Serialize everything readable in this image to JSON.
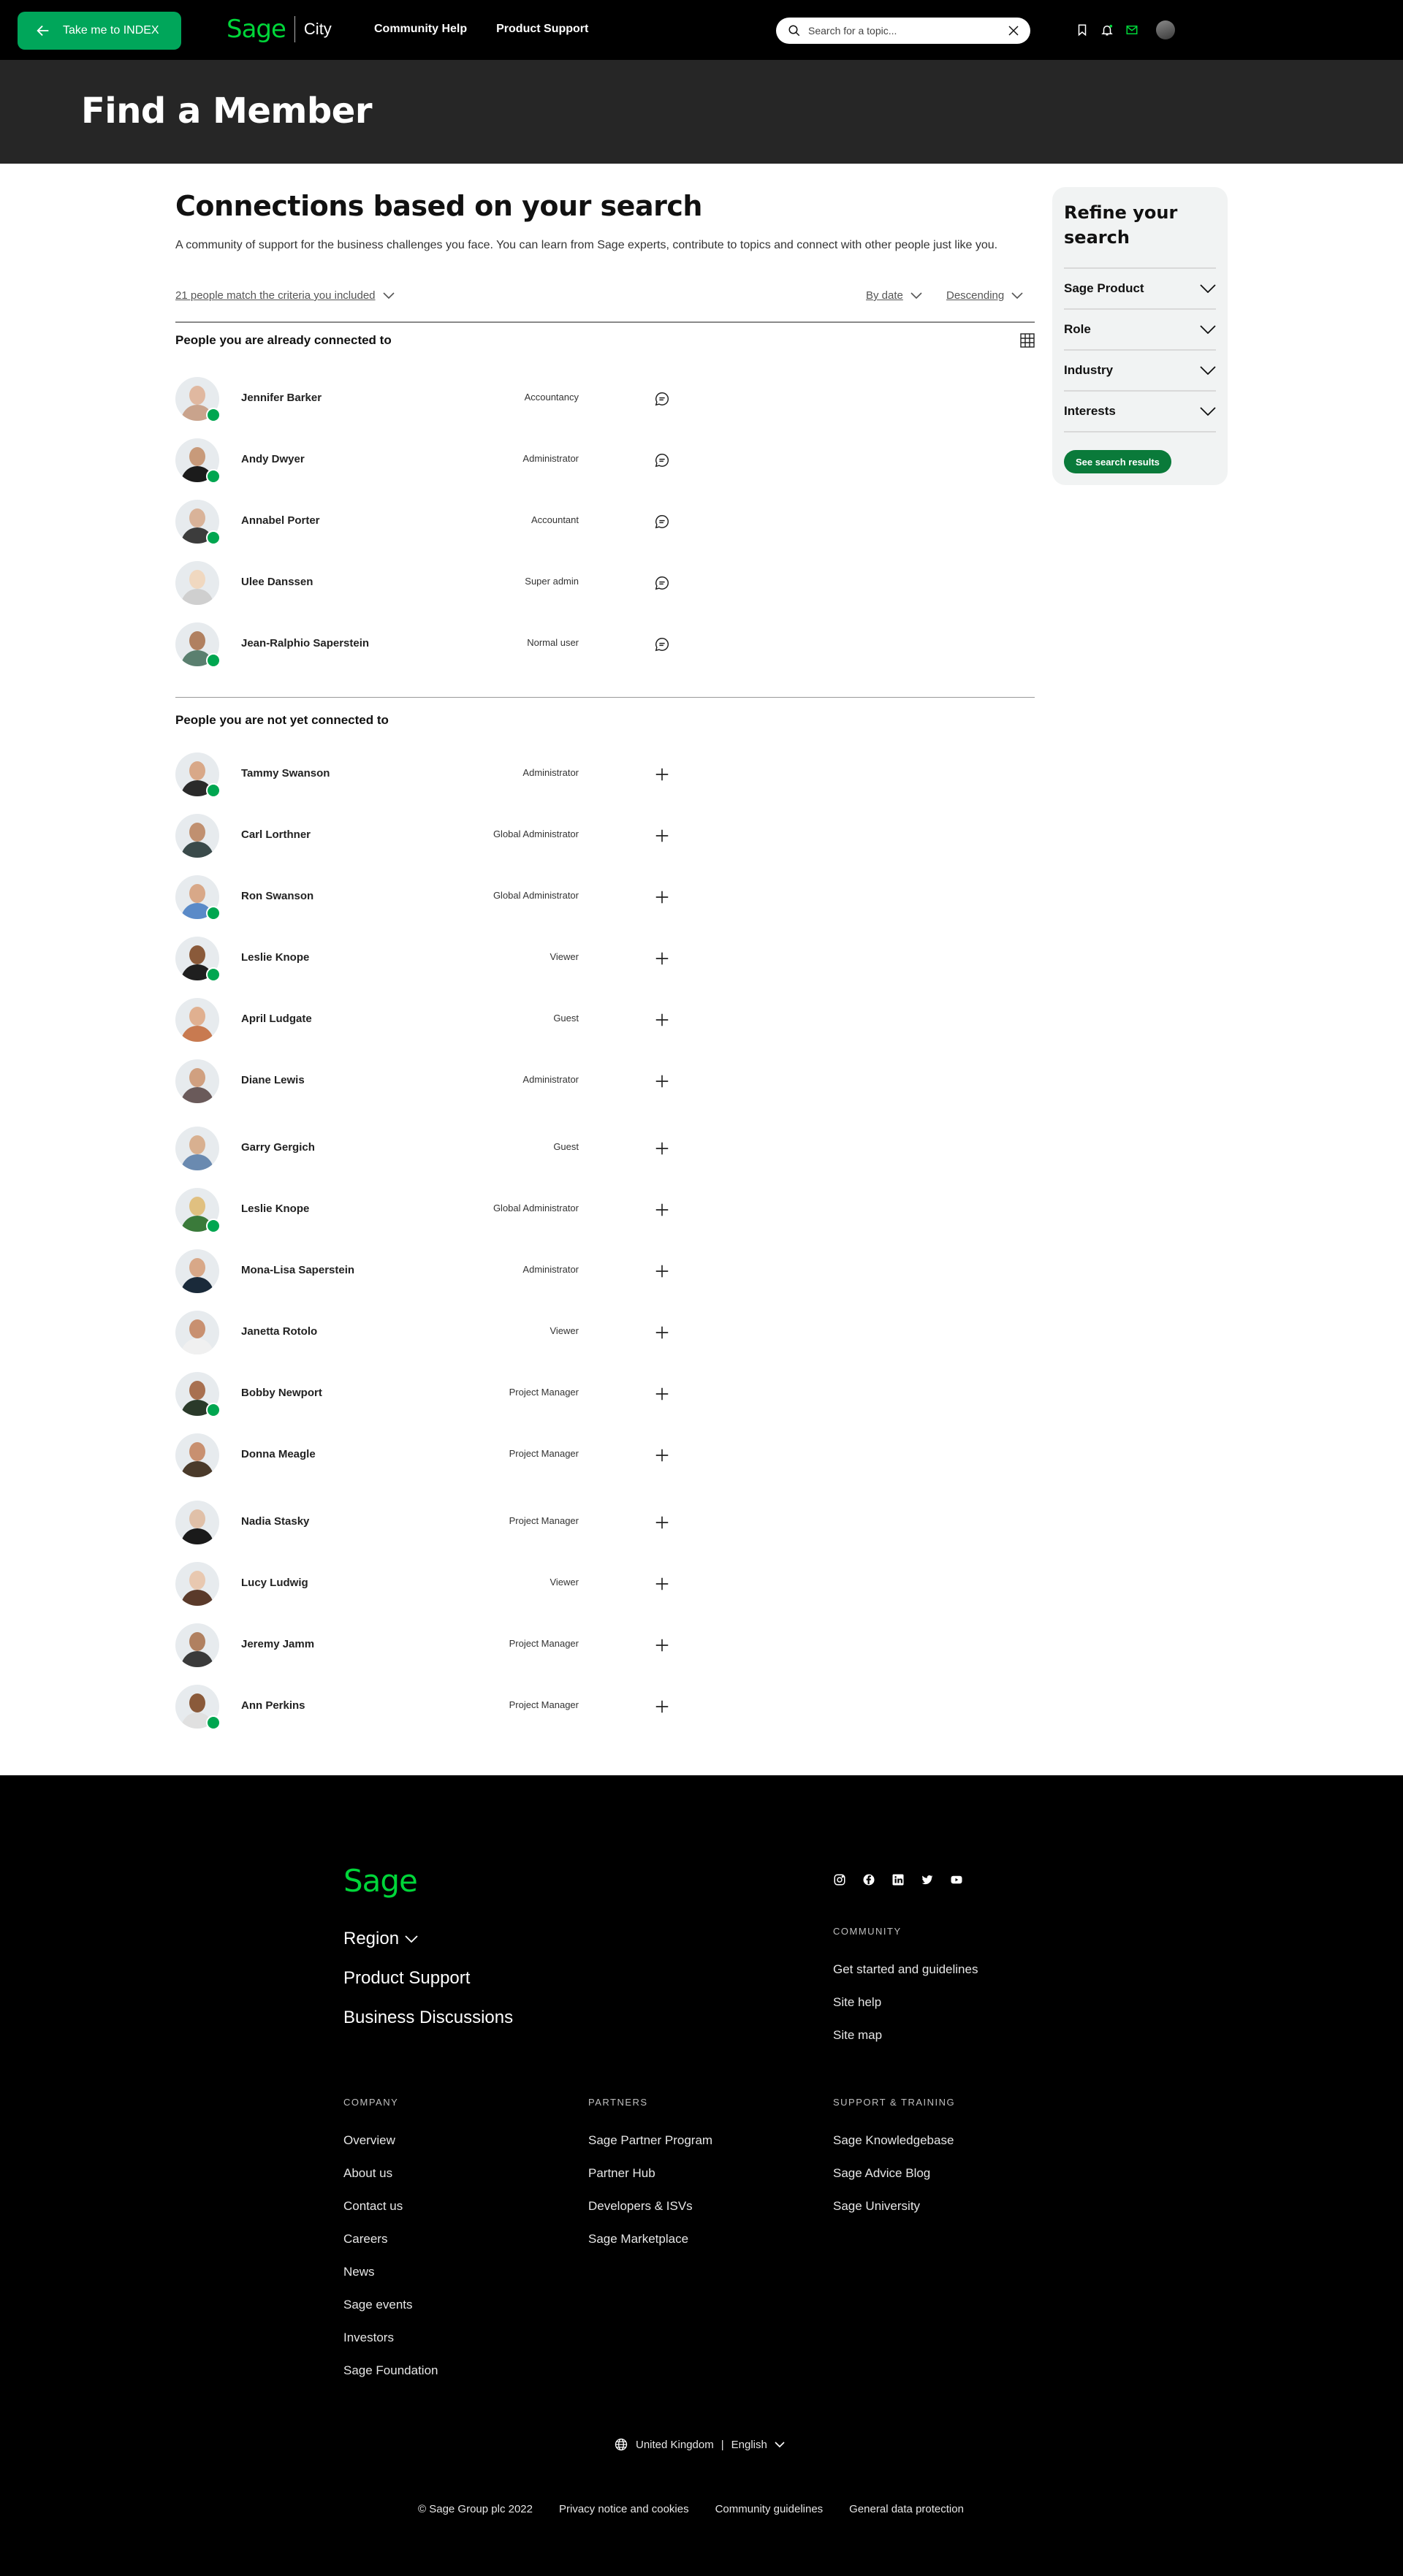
{
  "nav": {
    "back_label": "Take me to INDEX",
    "brand": "Sage",
    "brand_sub": "City",
    "links": [
      "Community Help",
      "Product Support"
    ],
    "search_placeholder": "Search for a topic..."
  },
  "hero": {
    "title": "Find a Member"
  },
  "main": {
    "title": "Connections based on your search",
    "intro": "A community of support for the business challenges you face. You can learn from Sage experts, contribute to topics and connect with other people just like you.",
    "match_text": "21 people match the criteria you included",
    "sort_by": "By date",
    "order": "Descending",
    "connected_title": "People you are already connected to",
    "not_connected_title": "People you are not yet connected to",
    "connected": [
      {
        "name": "Jennifer Barker",
        "role": "Accountancy",
        "online": true,
        "skin": "#e0b8a0",
        "cloth": "#c9a38c"
      },
      {
        "name": "Andy Dwyer",
        "role": "Administrator",
        "online": true,
        "skin": "#c89a7a",
        "cloth": "#1b1b1b"
      },
      {
        "name": "Annabel Porter",
        "role": "Accountant",
        "online": true,
        "skin": "#d9b399",
        "cloth": "#3c3c3c"
      },
      {
        "name": "Ulee Danssen",
        "role": "Super admin",
        "online": false,
        "skin": "#f0d8c0",
        "cloth": "#cfcfcf"
      },
      {
        "name": "Jean-Ralphio Saperstein",
        "role": "Normal user",
        "online": true,
        "skin": "#b08060",
        "cloth": "#5a7f6f"
      }
    ],
    "not_connected": [
      {
        "name": "Tammy Swanson",
        "role": "Administrator",
        "online": true,
        "skin": "#d8a888",
        "cloth": "#2a2a2a"
      },
      {
        "name": "Carl Lorthner",
        "role": "Global Administrator",
        "online": false,
        "skin": "#c09070",
        "cloth": "#3a4a4a"
      },
      {
        "name": "Ron Swanson",
        "role": "Global Administrator",
        "online": true,
        "skin": "#d8a888",
        "cloth": "#5a8ac8"
      },
      {
        "name": "Leslie Knope",
        "role": "Viewer",
        "online": true,
        "skin": "#8a5a3a",
        "cloth": "#1f1f1f"
      },
      {
        "name": "April Ludgate",
        "role": "Guest",
        "online": false,
        "skin": "#e0b090",
        "cloth": "#c87a50"
      },
      {
        "name": "Diane Lewis",
        "role": "Administrator",
        "online": false,
        "skin": "#d0a080",
        "cloth": "#6a5a5a"
      },
      {
        "name": "Garry Gergich",
        "role": "Guest",
        "online": false,
        "skin": "#d8b090",
        "cloth": "#6a8ab0"
      },
      {
        "name": "Leslie Knope",
        "role": "Global Administrator",
        "online": true,
        "skin": "#e0c080",
        "cloth": "#3a7a3a"
      },
      {
        "name": "Mona-Lisa Saperstein",
        "role": "Administrator",
        "online": false,
        "skin": "#d8a888",
        "cloth": "#1a2a3a"
      },
      {
        "name": "Janetta Rotolo",
        "role": "Viewer",
        "online": false,
        "skin": "#c89070",
        "cloth": "#f0f0f0"
      },
      {
        "name": "Bobby Newport",
        "role": "Project Manager",
        "online": true,
        "skin": "#a87050",
        "cloth": "#2a3a2a"
      },
      {
        "name": "Donna Meagle",
        "role": "Project Manager",
        "online": false,
        "skin": "#c89070",
        "cloth": "#4a3a2a"
      },
      {
        "name": "Nadia Stasky",
        "role": "Project Manager",
        "online": false,
        "skin": "#e0c0a8",
        "cloth": "#1a1a1a"
      },
      {
        "name": "Lucy Ludwig",
        "role": "Viewer",
        "online": false,
        "skin": "#e8c8b0",
        "cloth": "#5a3a2a"
      },
      {
        "name": "Jeremy Jamm",
        "role": "Project Manager",
        "online": false,
        "skin": "#b08060",
        "cloth": "#3a3a3a"
      },
      {
        "name": "Ann Perkins",
        "role": "Project Manager",
        "online": true,
        "skin": "#8a5a3a",
        "cloth": "#e0e0e0"
      }
    ]
  },
  "refine": {
    "title": "Refine your search",
    "filters": [
      "Sage Product",
      "Role",
      "Industry",
      "Interests"
    ],
    "button": "See search results"
  },
  "footer": {
    "logo": "Sage",
    "region": "Region",
    "big_links": [
      "Product Support",
      "Business Discussions"
    ],
    "socials": [
      "instagram-icon",
      "facebook-icon",
      "linkedin-icon",
      "twitter-icon",
      "youtube-icon"
    ],
    "community": {
      "heading": "COMMUNITY",
      "links": [
        "Get started and guidelines",
        "Site help",
        "Site map"
      ]
    },
    "company": {
      "heading": "COMPANY",
      "links": [
        "Overview",
        "About us",
        "Contact us",
        "Careers",
        "News",
        "Sage events",
        "Investors",
        "Sage Foundation"
      ]
    },
    "partners": {
      "heading": "PARTNERS",
      "links": [
        "Sage Partner Program",
        "Partner Hub",
        "Developers & ISVs",
        "Sage Marketplace"
      ]
    },
    "support": {
      "heading": "SUPPORT & TRAINING",
      "links": [
        "Sage Knowledgebase",
        "Sage Advice Blog",
        "Sage University"
      ]
    },
    "locale": {
      "country": "United Kingdom",
      "language": "English"
    },
    "bottom_links": [
      "© Sage Group plc 2022",
      "Privacy notice and cookies",
      "Community guidelines",
      "General data protection"
    ]
  },
  "colors": {
    "brand_green": "#00d639",
    "button_green": "#00a65a",
    "dark_green": "#0a7a3a",
    "online_dot": "#00a650"
  }
}
